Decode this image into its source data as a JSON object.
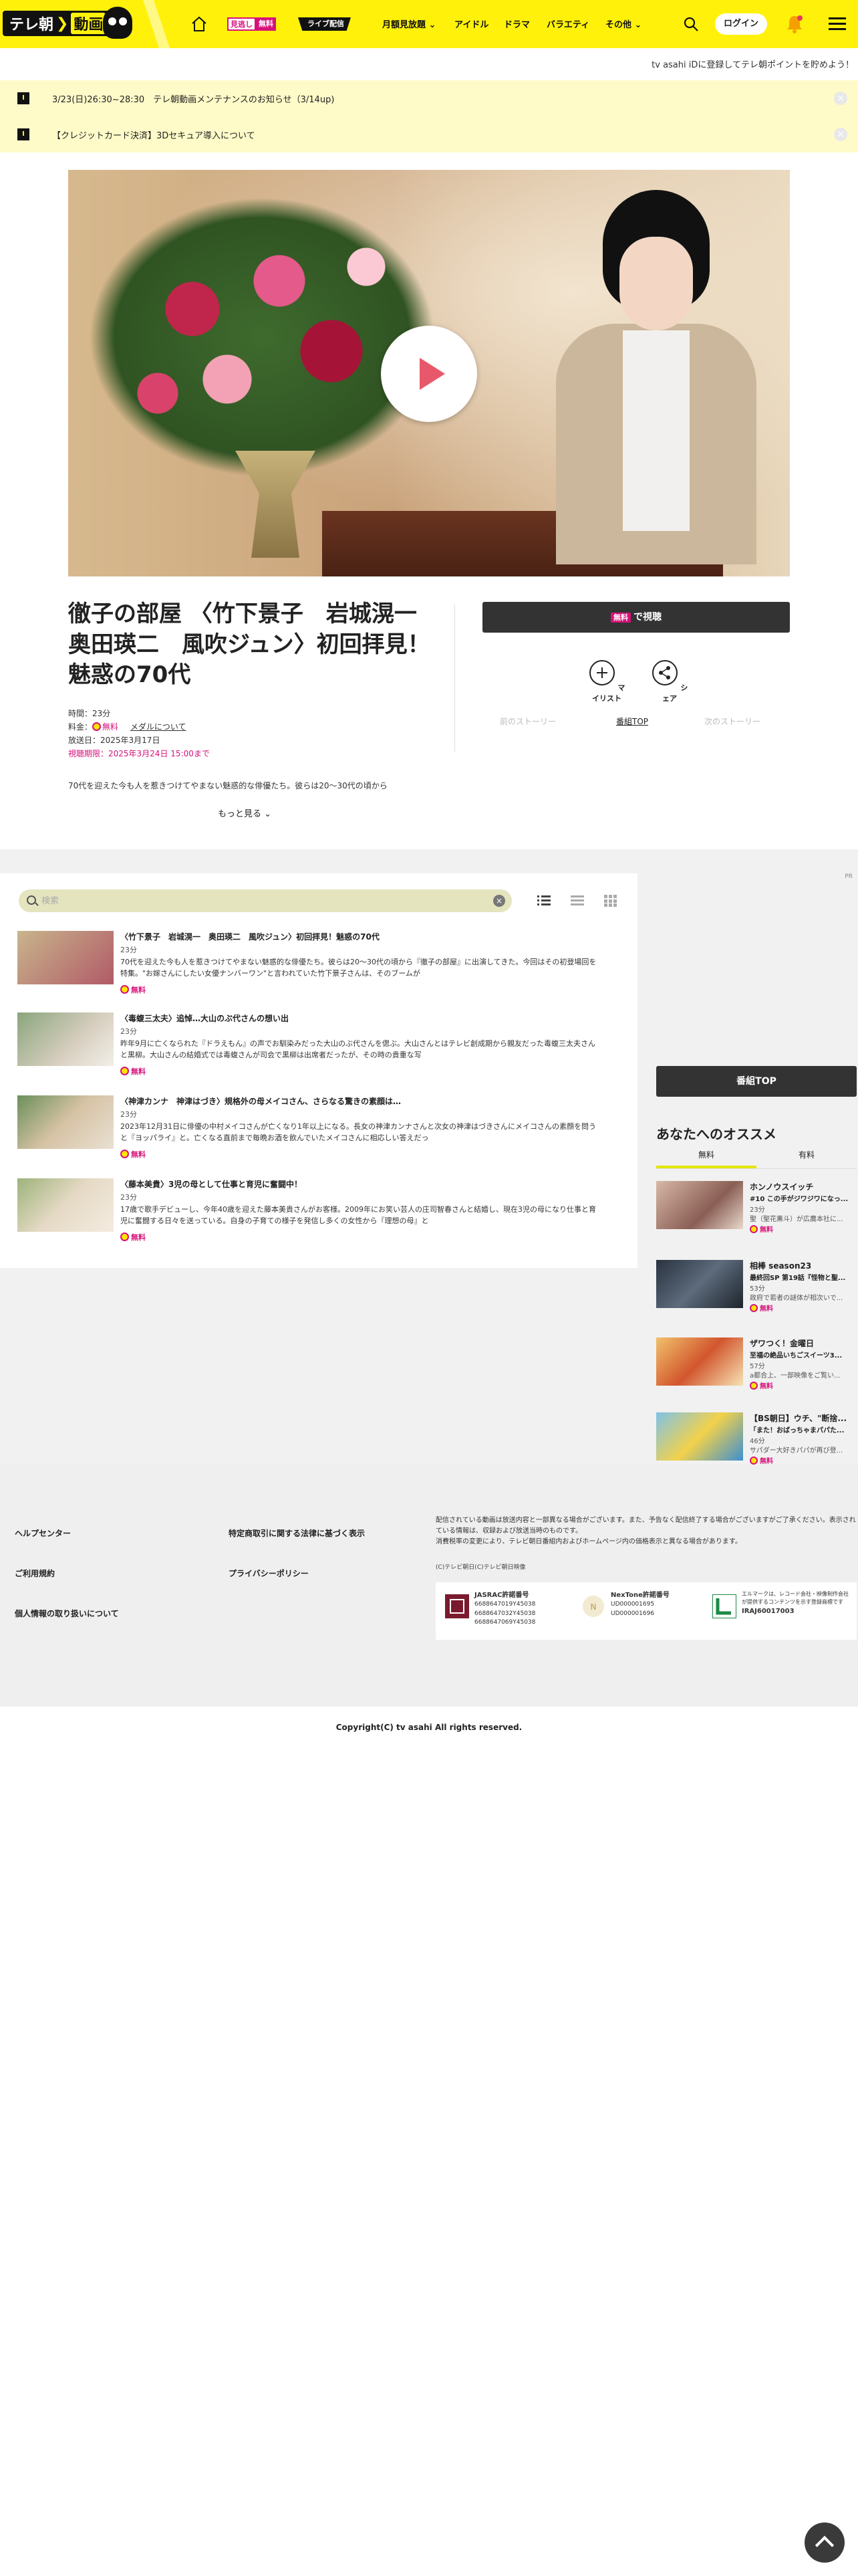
{
  "header": {
    "logo_text": "テレ朝",
    "logo_text2": "動画",
    "mitoshi_a": "見逃し",
    "mitoshi_b": "無料",
    "live": "ライブ配信",
    "nav": [
      "月額見放題",
      "アイドル",
      "ドラマ",
      "バラエティ",
      "その他"
    ],
    "login": "ログイン"
  },
  "sub_note": "tv asahi iDに登録してテレ朝ポイントを貯めよう！",
  "notices": [
    "3/23(日)26:30~28:30　テレ朝動画メンテナンスのお知らせ（3/14up)",
    "【クレジットカード決済】3Dセキュア導入について"
  ],
  "program": {
    "title": "徹子の部屋 〈竹下景子　岩城滉一　奥田瑛二　風吹ジュン〉初回拝見！魅惑の70代",
    "duration": "時間：23分",
    "price_label": "料金：",
    "price_value": "無料",
    "member_link": "メダルについて",
    "broadcast": "放送日：2025年3月17日",
    "deadline": "視聴期限：2025年3月24日 15:00まで",
    "description": "70代を迎えた今も人を惹きつけてやまない魅惑的な俳優たち。彼らは20～30代の頃から",
    "more": "もっと見る"
  },
  "actions": {
    "watch_free": "無料",
    "watch": "で視聴",
    "mylist": "マイリスト",
    "share": "シェア",
    "prev_story": "前のストーリー",
    "program_top": "番組TOP",
    "next_story": "次のストーリー"
  },
  "list": {
    "search_placeholder": "検索",
    "ad_mark": "PR",
    "items": [
      {
        "title": "〈竹下景子　岩城滉一　奥田瑛二　風吹ジュン〉初回拝見！魅惑の70代",
        "duration": "23分",
        "desc": "70代を迎えた今も人を惹きつけてやまない魅惑的な俳優たち。彼らは20～30代の頃から『徹子の部屋』に出演してきた。今回はその初登場回を特集。\"お嫁さんにしたい女優ナンバーワン\"と言われていた竹下景子さんは、そのブームが",
        "free": "無料"
      },
      {
        "title": "〈毒蝮三太夫〉追悼…大山のぶ代さんの想い出",
        "duration": "23分",
        "desc": "昨年9月に亡くなられた『ドラえもん』の声でお馴染みだった大山のぶ代さんを偲ぶ。大山さんとはテレビ創成期から親友だった毒蝮三太夫さんと黒柳。大山さんの結婚式では毒蝮さんが司会で黒柳は出席者だったが、その時の貴重な写",
        "free": "無料"
      },
      {
        "title": "〈神津カンナ　神津はづき〉規格外の母メイコさん、さらなる驚きの素顔は…",
        "duration": "23分",
        "desc": "2023年12月31日に俳優の中村メイコさんが亡くなり1年以上になる。長女の神津カンナさんと次女の神津はづきさんにメイコさんの素顔を問うと『ヨッパライ』と。亡くなる直前まで毎晩お酒を飲んでいたメイコさんに相応しい答えだっ",
        "free": "無料"
      },
      {
        "title": "〈藤本美貴〉3児の母として仕事と育児に奮闘中！",
        "duration": "23分",
        "desc": "17歳で歌手デビューし、今年40歳を迎えた藤本美貴さんがお客様。2009年にお笑い芸人の庄司智春さんと結婚し、現在3児の母になり仕事と育児に奮闘する日々を送っている。自身の子育ての様子を発信し多くの女性から『理想の母』と",
        "free": "無料"
      }
    ]
  },
  "sidebar": {
    "program_top": "番組TOP",
    "recommend_title": "あなたへのオススメ",
    "tab_free": "無料",
    "tab_paid": "有料",
    "recs": [
      {
        "title": "ホンノウスイッチ",
        "sub": "#10 この手がジワジワになっ...",
        "dur": "23分",
        "extra": "聖（聖花薫斗）が広農本社に...",
        "free": "無料"
      },
      {
        "title": "相棒 season23",
        "sub": "最終回SP 第19話『怪物と聖...",
        "dur": "53分",
        "extra": "政府で若者の謎体が相次いで...",
        "free": "無料"
      },
      {
        "title": "ザワつく！金曜日",
        "sub": "至福の絶品いちごスイーツ3...",
        "dur": "57分",
        "extra": "a都合上、一部映像をご覧い...",
        "free": "無料"
      },
      {
        "title": "【BS朝日】ウチ、\"断捨...",
        "sub": "「また！おばっちゃまパパた...",
        "dur": "46分",
        "extra": "サパダー大好きパパが再び登...",
        "free": "無料"
      }
    ]
  },
  "footer": {
    "links_left": [
      "ヘルプセンター",
      "ご利用規約",
      "個人情報の取り扱いについて"
    ],
    "links_mid": [
      "特定商取引に関する法律に基づく表示",
      "プライバシーポリシー"
    ],
    "note": "配信されている動画は放送内容と一部異なる場合がございます。また、予告なく配信終了する場合がございますがご了承ください。表示されている情報は、収録および放送当時のものです。\n消費税率の変更により、テレビ朝日番組内およびホームページ内の価格表示と異なる場合があります。",
    "small": "(C)テレビ朝日(C)テレビ朝日映像",
    "jasrac_name": "JASRAC許諾番号",
    "jasrac_nums": "6688647019Y45038\n6688647032Y45038\n6688647069Y45038",
    "nextone_name": "NexTone許諾番号",
    "nextone_nums": "UD000001695\nUD000001696",
    "lmark_text": "エルマークは、レコード会社・映像制作会社が提供するコンテンツを示す登録商標です",
    "lmark_num": "IRAJ60017003",
    "copyright": "Copyright(C) tv asahi All rights reserved."
  }
}
